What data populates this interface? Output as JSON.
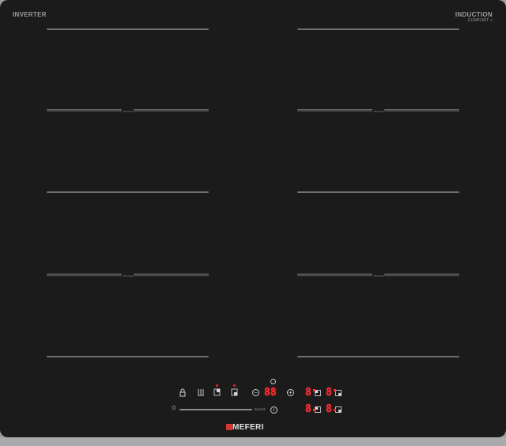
{
  "labels": {
    "inverter": "INVERTER",
    "induction": "INDUCTION",
    "comfort": "COMFORT +",
    "bridge_text": "BRIDGE",
    "brand": "MEFERI"
  },
  "controls": {
    "lock_icon": "lock-icon",
    "keep_warm_icon": "keep-warm-icon",
    "zone_select_1_icon": "zone-select-icon",
    "zone_select_2_icon": "zone-select-icon",
    "minus_label": "−",
    "plus_label": "+",
    "info_label": "i",
    "timer_display": "88",
    "zone_display_1": "8",
    "zone_display_2": "8",
    "zone_display_3": "8",
    "zone_display_4": "8",
    "slider_start": "0",
    "slider_end": "BOOST"
  },
  "colors": {
    "glass": "#1b1b1c",
    "display_red": "#ff2e34",
    "brand_red": "#d8362e"
  }
}
